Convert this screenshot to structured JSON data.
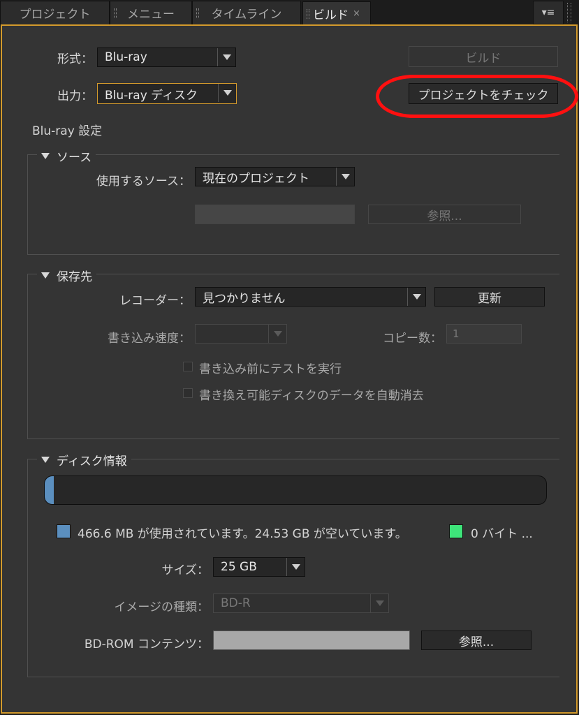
{
  "tabs": [
    {
      "label": "プロジェクト"
    },
    {
      "label": "メニュー"
    },
    {
      "label": "タイムライン"
    },
    {
      "label": "ビルド"
    }
  ],
  "tab_close_glyph": "×",
  "panel_menu_glyph": "▾≡",
  "format": {
    "label": "形式：",
    "value": "Blu-ray"
  },
  "output": {
    "label": "出力：",
    "value": "Blu-ray ディスク"
  },
  "build_button": "ビルド",
  "check_project_button": "プロジェクトをチェック",
  "settings_title": "Blu-ray 設定",
  "source": {
    "title": "ソース",
    "use_label": "使用するソース：",
    "use_value": "現在のプロジェクト",
    "browse_button": "参照..."
  },
  "destination": {
    "title": "保存先",
    "recorder_label": "レコーダー：",
    "recorder_value": "見つかりません",
    "refresh_button": "更新",
    "speed_label": "書き込み速度：",
    "copies_label": "コピー数：",
    "copies_value": "1",
    "test_before_write": "書き込み前にテストを実行",
    "auto_erase": "書き換え可能ディスクのデータを自動消去"
  },
  "disc_info": {
    "title": "ディスク情報",
    "used_fraction": 0.018,
    "usage_text": "466.6 MB が使用されています。24.53 GB が空いています。",
    "other_text": "0 バイト ...",
    "used_color": "#5b8fbf",
    "other_color": "#3ee47a",
    "size_label": "サイズ：",
    "size_value": "25 GB",
    "image_type_label": "イメージの種類：",
    "image_type_value": "BD-R",
    "bdrom_label": "BD-ROM コンテンツ：",
    "bdrom_browse_button": "参照..."
  }
}
